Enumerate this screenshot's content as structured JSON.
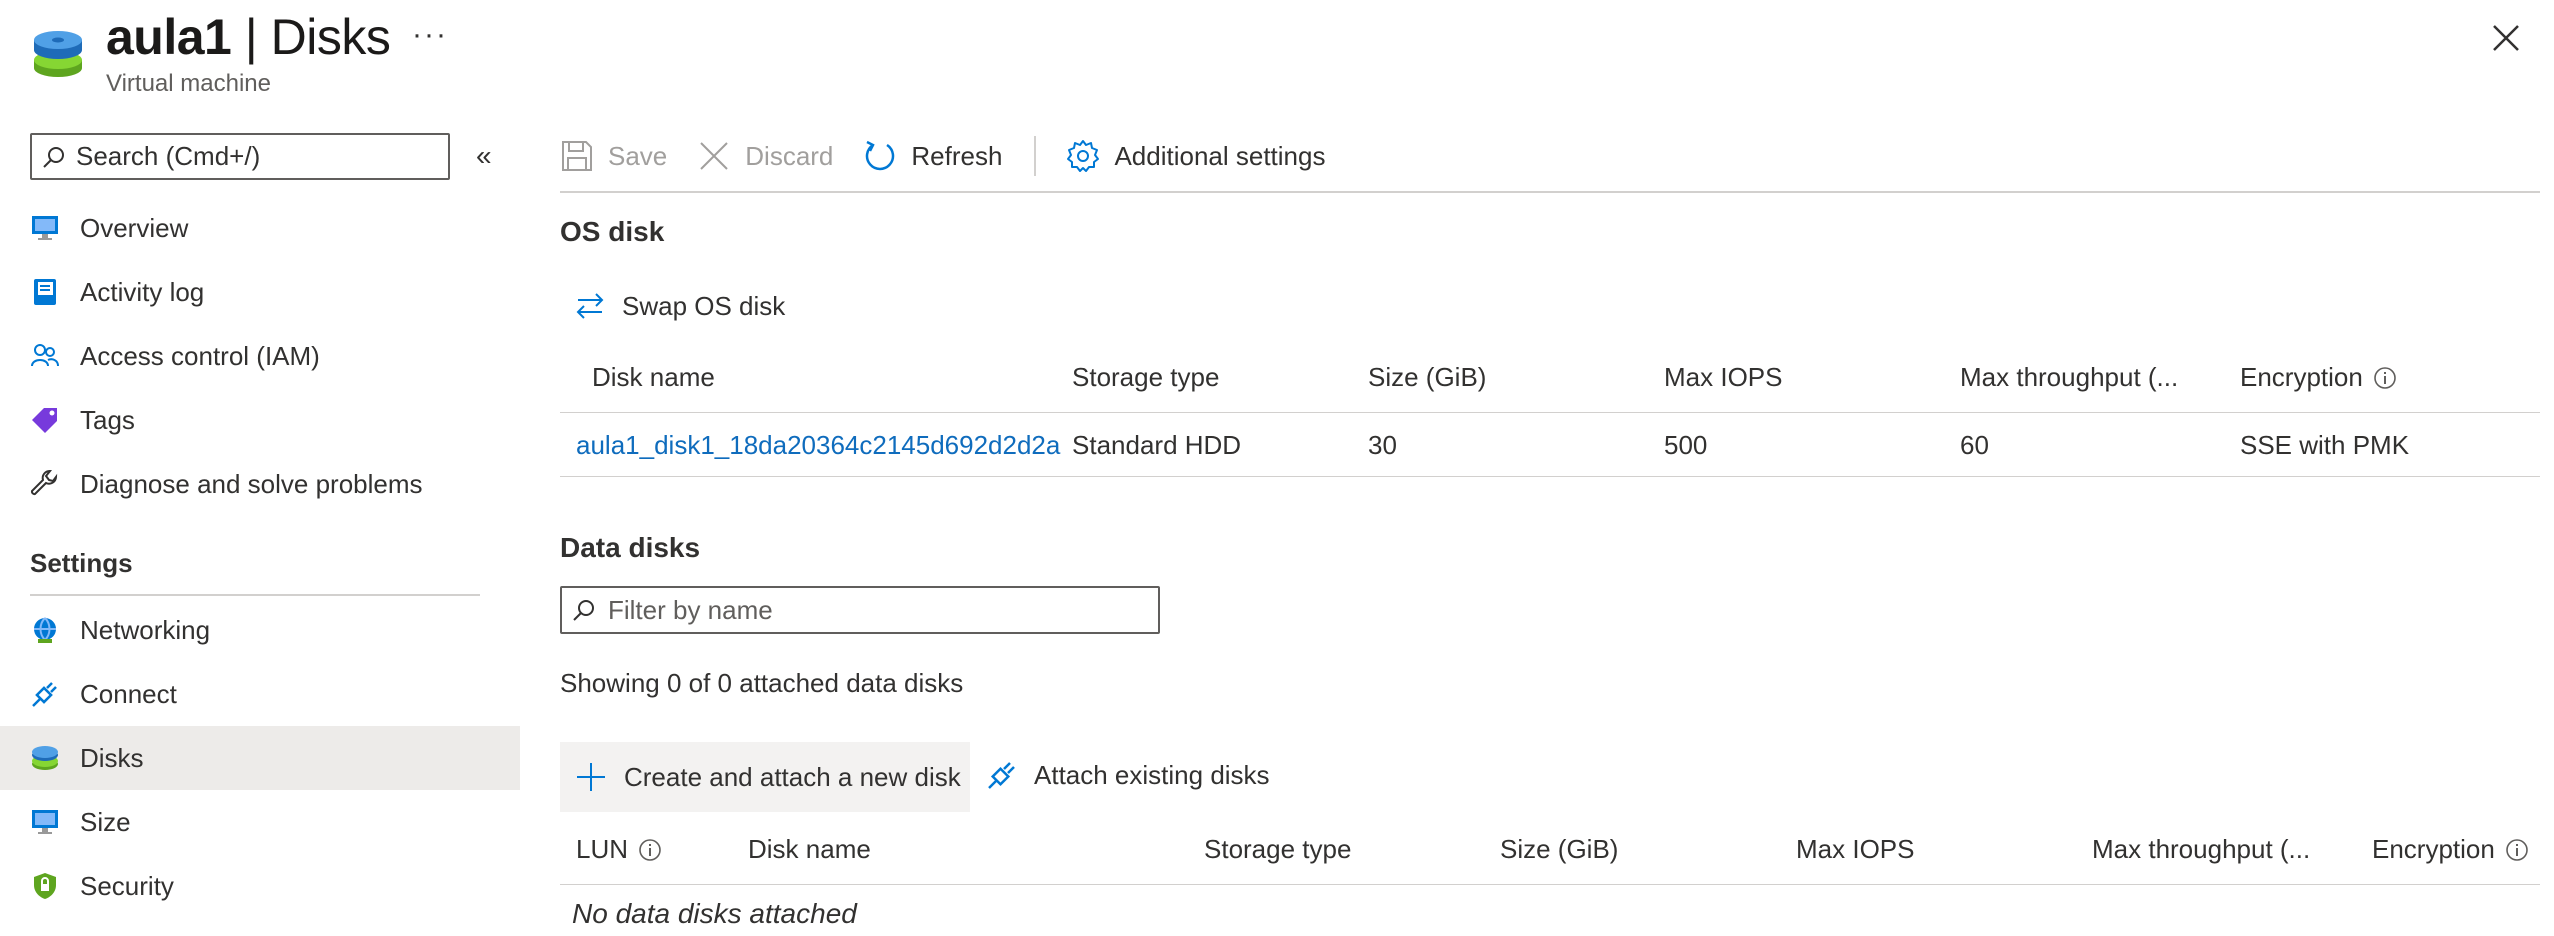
{
  "header": {
    "title_resource": "aula1",
    "title_rest": " | Disks",
    "subtitle": "Virtual machine",
    "more": "···"
  },
  "sidebar": {
    "search_placeholder": "Search (Cmd+/)",
    "collapse": "«",
    "items": [
      {
        "label": "Overview",
        "icon": "monitor-icon"
      },
      {
        "label": "Activity log",
        "icon": "log-icon"
      },
      {
        "label": "Access control (IAM)",
        "icon": "people-icon"
      },
      {
        "label": "Tags",
        "icon": "tag-icon"
      },
      {
        "label": "Diagnose and solve problems",
        "icon": "wrench-icon"
      }
    ],
    "settings_header": "Settings",
    "settings_items": [
      {
        "label": "Networking",
        "icon": "network-icon"
      },
      {
        "label": "Connect",
        "icon": "plug-icon"
      },
      {
        "label": "Disks",
        "icon": "disk-icon",
        "selected": true
      },
      {
        "label": "Size",
        "icon": "size-icon"
      },
      {
        "label": "Security",
        "icon": "shield-icon"
      }
    ]
  },
  "toolbar": {
    "save": "Save",
    "discard": "Discard",
    "refresh": "Refresh",
    "additional_settings": "Additional settings"
  },
  "os_disk": {
    "title": "OS disk",
    "swap": "Swap OS disk",
    "columns": [
      "Disk name",
      "Storage type",
      "Size (GiB)",
      "Max IOPS",
      "Max throughput (...",
      "Encryption"
    ],
    "row": {
      "name": "aula1_disk1_18da20364c2145d692d2d2a",
      "storage_type": "Standard HDD",
      "size": "30",
      "max_iops": "500",
      "max_throughput": "60",
      "encryption": "SSE with PMK"
    }
  },
  "data_disks": {
    "title": "Data disks",
    "filter_placeholder": "Filter by name",
    "showing": "Showing 0 of 0 attached data disks",
    "create": "Create and attach a new disk",
    "attach": "Attach existing disks",
    "columns": [
      "LUN",
      "Disk name",
      "Storage type",
      "Size (GiB)",
      "Max IOPS",
      "Max throughput (...",
      "Encryption"
    ],
    "empty": "No data disks attached"
  },
  "colors": {
    "accent": "#0f6cbd",
    "selected_bg": "#edebe9"
  }
}
